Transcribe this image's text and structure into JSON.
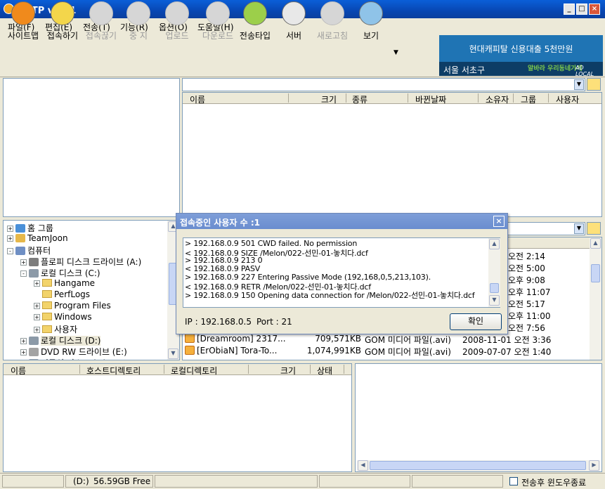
{
  "window": {
    "title": "알FTP v5.21",
    "min": "_",
    "max": "□",
    "close": "×"
  },
  "menu": [
    "파일(F)",
    "편집(E)",
    "전송(T)",
    "기능(R)",
    "옵션(O)",
    "도움말(H)"
  ],
  "toolbar": [
    {
      "label": "사이트맵",
      "icon": "sitemap-icon",
      "enabled": true,
      "color": "#f08a1c"
    },
    {
      "label": "접속하기",
      "icon": "connect-icon",
      "enabled": true,
      "color": "#f3d64b"
    },
    {
      "label": "접속끊기",
      "icon": "disconnect-icon",
      "enabled": false,
      "color": "#d6d6d6"
    },
    {
      "label": "중 지",
      "icon": "stop-icon",
      "enabled": false,
      "color": "#d6d6d6"
    },
    {
      "label": "업로드",
      "icon": "upload-icon",
      "enabled": false,
      "color": "#d6d6d6"
    },
    {
      "label": "다운로드",
      "icon": "download-icon",
      "enabled": false,
      "color": "#d6d6d6"
    },
    {
      "label": "전송타입",
      "icon": "transfer-type-icon",
      "enabled": true,
      "color": "#9ccf4a"
    },
    {
      "label": "서버",
      "icon": "server-icon",
      "enabled": true,
      "color": "#e8e8e8"
    },
    {
      "label": "새로고침",
      "icon": "refresh-icon",
      "enabled": false,
      "color": "#d6d6d6"
    },
    {
      "label": "보기",
      "icon": "view-icon",
      "enabled": true,
      "color": "#8fc3e8"
    }
  ],
  "toolbar_more": "▼",
  "ad": {
    "line1": "현대캐피탈 신용대출 5천만원",
    "line2": "서울 서초구",
    "logo": "알바라 우리동네가게",
    "brand": "AD LOCAL"
  },
  "remote": {
    "path": "",
    "columns": [
      "이름",
      "크기",
      "종류",
      "바뀐날짜",
      "소유자",
      "그룹",
      "사용자"
    ]
  },
  "tree": [
    {
      "label": "홈 그룹",
      "level": 0,
      "exp": "+",
      "icon": "homegroup-icon"
    },
    {
      "label": "TeamJoon",
      "level": 0,
      "exp": "+",
      "icon": "user-folder-icon"
    },
    {
      "label": "컴퓨터",
      "level": 0,
      "exp": "-",
      "icon": "computer-icon"
    },
    {
      "label": "플로피 디스크 드라이브 (A:)",
      "level": 1,
      "exp": "+",
      "icon": "floppy-icon"
    },
    {
      "label": "로컬 디스크 (C:)",
      "level": 1,
      "exp": "-",
      "icon": "drive-icon"
    },
    {
      "label": "Hangame",
      "level": 2,
      "exp": "+",
      "icon": "folder-icon"
    },
    {
      "label": "PerfLogs",
      "level": 2,
      "exp": "",
      "icon": "folder-icon"
    },
    {
      "label": "Program Files",
      "level": 2,
      "exp": "+",
      "icon": "folder-icon"
    },
    {
      "label": "Windows",
      "level": 2,
      "exp": "+",
      "icon": "folder-icon"
    },
    {
      "label": "사용자",
      "level": 2,
      "exp": "+",
      "icon": "folder-icon"
    },
    {
      "label": "로컬 디스크 (D:)",
      "level": 1,
      "exp": "+",
      "icon": "drive-icon",
      "selected": true
    },
    {
      "label": "DVD RW 드라이브 (E:)",
      "level": 1,
      "exp": "+",
      "icon": "dvd-icon"
    },
    {
      "label": "이동식 디스크 (F:)",
      "level": 1,
      "exp": "+",
      "icon": "removable-icon"
    }
  ],
  "local_files": [
    {
      "name": "",
      "size": "",
      "type": "",
      "date": "오전 2:14"
    },
    {
      "name": "",
      "size": "",
      "type": "",
      "date": "오전 5:00"
    },
    {
      "name": "",
      "size": "",
      "type": "",
      "date": "오후 9:08"
    },
    {
      "name": "",
      "size": "",
      "type": "",
      "date": "오후 11:07"
    },
    {
      "name": "",
      "size": "",
      "type": "",
      "date": "오전 5:17"
    },
    {
      "name": "",
      "size": "",
      "type": "",
      "date": "오후 11:00"
    },
    {
      "name": "",
      "size": "",
      "type": "",
      "date": "오전 7:56"
    },
    {
      "name": "[Dreamroom] 2317...",
      "size": "709,571KB",
      "type": "GOM 미디어 파일(.avi)",
      "date": "2008-11-01 오전 3:36"
    },
    {
      "name": "[ErObiaN] Tora-To...",
      "size": "1,074,991KB",
      "type": "GOM 미디어 파일(.avi)",
      "date": "2009-07-07 오전 1:40"
    }
  ],
  "queue": {
    "columns": [
      "이름",
      "호스트디렉토리",
      "로컬디렉토리",
      "크기",
      "상태"
    ]
  },
  "dialog": {
    "title": "접속중인 사용자 수 :1",
    "log": [
      "> 192.168.0.9 501 CWD failed. No permission",
      "< 192.168.0.9 SIZE /Melon/022-선민-01-놓치다.dcf",
      "> 192.168.0.9 213 0",
      "< 192.168.0.9 PASV",
      "> 192.168.0.9 227 Entering Passive Mode (192,168,0,5,213,103).",
      "< 192.168.0.9 RETR /Melon/022-선민-01-놓치다.dcf",
      "> 192.168.0.9 150 Opening data connection for /Melon/022-선민-01-놓치다.dcf"
    ],
    "ip_text": "IP : 192.168.0.5",
    "port_text": "Port : 21",
    "ok": "확인"
  },
  "status": {
    "drive": "(D:)",
    "free": "56.59GB Free",
    "autoclose": "전송후 윈도우종료"
  }
}
